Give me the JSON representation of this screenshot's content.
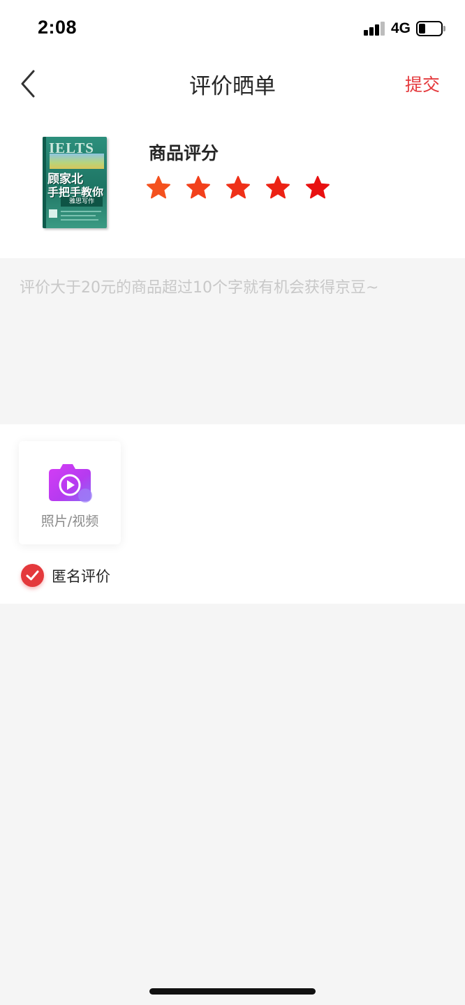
{
  "status_bar": {
    "time": "2:08",
    "network": "4G",
    "signal_bars": 4,
    "signal_bars_active": 3,
    "battery_level": 0.3
  },
  "nav": {
    "back_icon": "chevron-left-icon",
    "title": "评价晒单",
    "submit_label": "提交"
  },
  "product": {
    "cover": {
      "series": "IELTS",
      "title_line1": "顾家北",
      "title_line2": "手把手教你",
      "subtitle": "雅思写作"
    },
    "rating_label": "商品评分",
    "rating": 5,
    "max_rating": 5,
    "star_colors": [
      "#f4511e",
      "#f2401b",
      "#ef3018",
      "#ec2214",
      "#e81010"
    ]
  },
  "comment": {
    "placeholder": "评价大于20元的商品超过10个字就有机会获得京豆~",
    "value": ""
  },
  "media": {
    "icon": "camera-video-icon",
    "label": "照片/视频"
  },
  "anonymous": {
    "label": "匿名评价",
    "checked": true
  },
  "colors": {
    "accent": "#e4393c",
    "background": "#f5f5f5",
    "card": "#ffffff"
  }
}
